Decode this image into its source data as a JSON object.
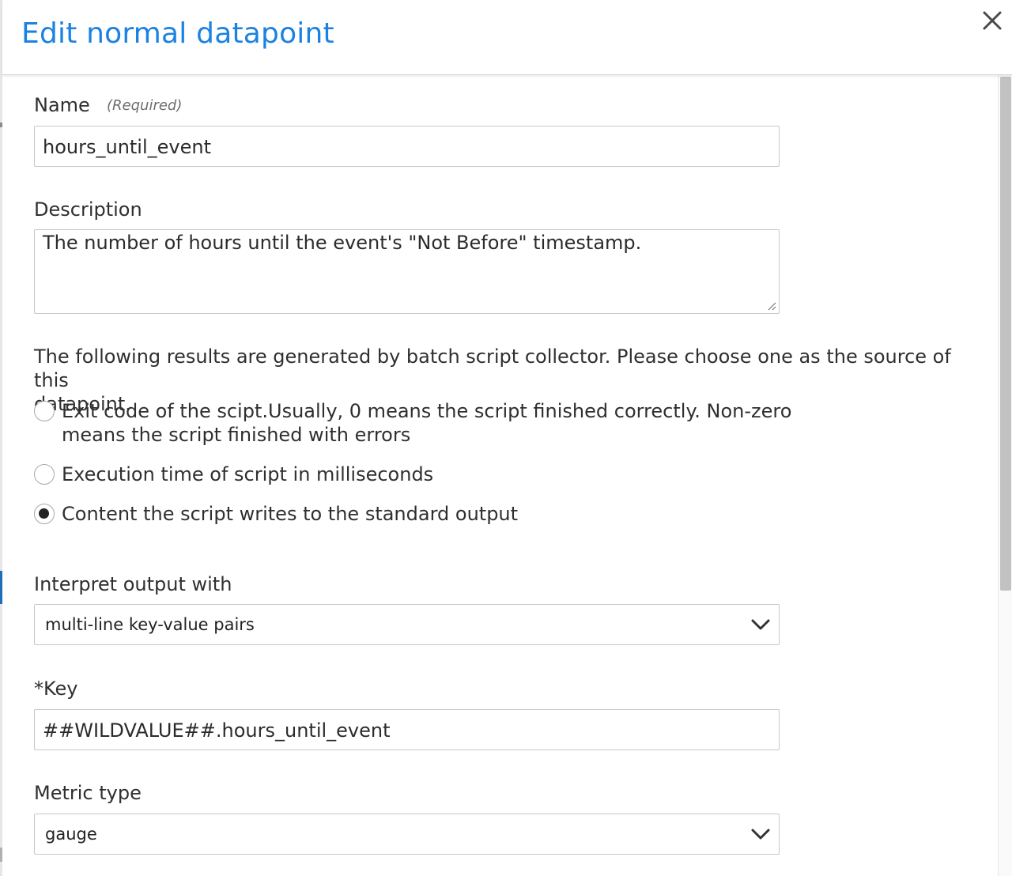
{
  "dialog": {
    "title": "Edit normal datapoint"
  },
  "form": {
    "name": {
      "label": "Name",
      "required_note": "(Required)",
      "value": "hours_until_event"
    },
    "description": {
      "label": "Description",
      "value": "The number of hours until the event's \"Not Before\" timestamp."
    },
    "source": {
      "intro_line1": "The following results are generated by batch script collector. Please choose one as the source of this",
      "intro_line2": "datapoint.",
      "options": [
        {
          "line1": "Exit code of the scipt.Usually, 0 means the script finished correctly. Non-zero",
          "line2": "means the script finished with errors",
          "checked": false
        },
        {
          "line1": "Execution time of script in milliseconds",
          "checked": false
        },
        {
          "line1": "Content the script writes to the standard output",
          "checked": true
        }
      ]
    },
    "interpret": {
      "label": "Interpret output with",
      "value": "multi-line key-value pairs"
    },
    "key": {
      "label": "*Key",
      "value": "##WILDVALUE##.hours_until_event"
    },
    "metric_type": {
      "label": "Metric type",
      "value": "gauge"
    }
  },
  "icons": {
    "close": "close-icon",
    "dropdown": "chevron-down-icon"
  }
}
